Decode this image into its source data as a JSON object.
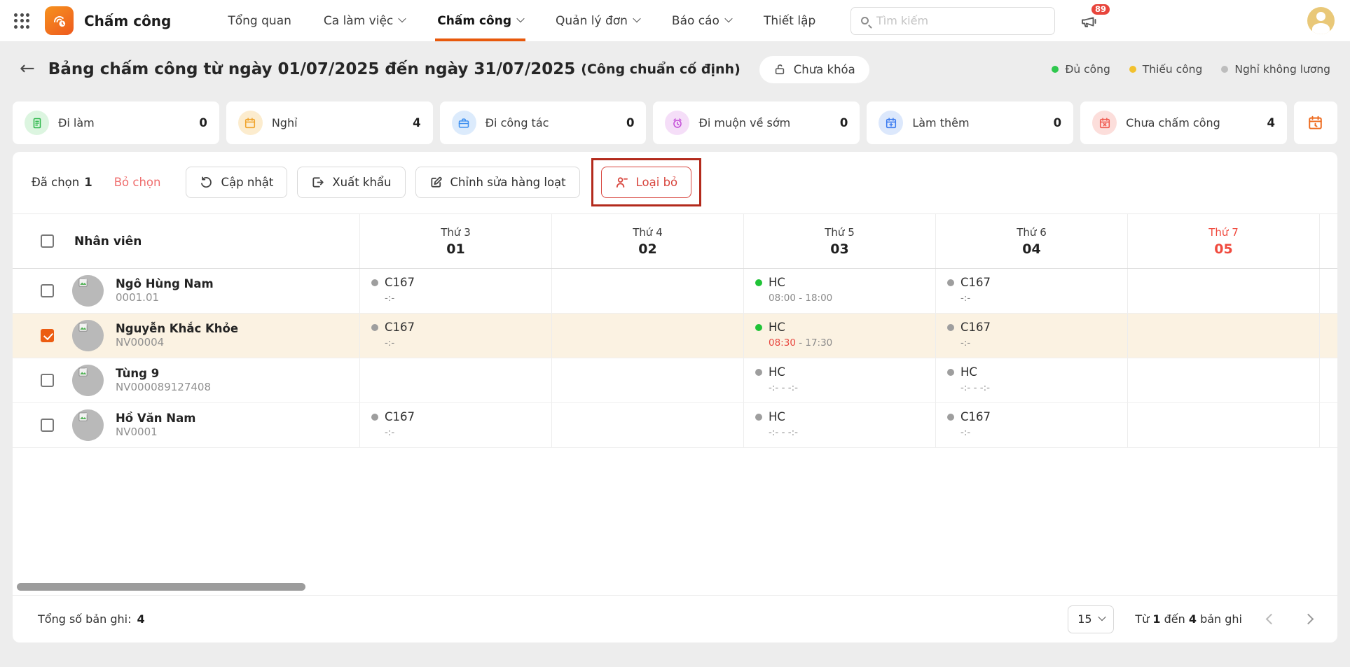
{
  "topbar": {
    "app_title": "Chấm công",
    "nav": [
      {
        "label": "Tổng quan",
        "chevron": false,
        "active": false
      },
      {
        "label": "Ca làm việc",
        "chevron": true,
        "active": false
      },
      {
        "label": "Chấm công",
        "chevron": true,
        "active": true
      },
      {
        "label": "Quản lý đơn",
        "chevron": true,
        "active": false
      },
      {
        "label": "Báo cáo",
        "chevron": true,
        "active": false
      },
      {
        "label": "Thiết lập",
        "chevron": false,
        "active": false
      }
    ],
    "search_placeholder": "Tìm kiếm",
    "notification_count": "89"
  },
  "page_header": {
    "title": "Bảng chấm công từ ngày 01/07/2025 đến ngày 31/07/2025",
    "subtitle": "(Công chuẩn cố định)",
    "lock_status": "Chưa khóa",
    "legend": [
      {
        "label": "Đủ công",
        "color": "#2fc84e"
      },
      {
        "label": "Thiếu công",
        "color": "#f2c12e"
      },
      {
        "label": "Nghỉ không lương",
        "color": "#bdbdbd"
      }
    ]
  },
  "status_cards": [
    {
      "label": "Đi làm",
      "count": "0",
      "icon": "attendance-doc-icon",
      "color": "#2eb84c",
      "bg": "#dcf5e0"
    },
    {
      "label": "Nghỉ",
      "count": "4",
      "icon": "leave-calendar-icon",
      "color": "#f0a32a",
      "bg": "#fcecce"
    },
    {
      "label": "Đi công tác",
      "count": "0",
      "icon": "business-trip-icon",
      "color": "#3b8ef0",
      "bg": "#dcebfc"
    },
    {
      "label": "Đi muộn về sớm",
      "count": "0",
      "icon": "late-early-alarm-icon",
      "color": "#c44fd8",
      "bg": "#f5def8"
    },
    {
      "label": "Làm thêm",
      "count": "0",
      "icon": "overtime-calendar-icon",
      "color": "#3b7bf0",
      "bg": "#dce8fc"
    },
    {
      "label": "Chưa chấm công",
      "count": "4",
      "icon": "missing-calendar-icon",
      "color": "#f05a50",
      "bg": "#fcdedb"
    }
  ],
  "toolbar": {
    "selected_label": "Đã chọn",
    "selected_count": "1",
    "deselect_label": "Bỏ chọn",
    "update_label": "Cập nhật",
    "export_label": "Xuất khẩu",
    "bulk_edit_label": "Chỉnh sửa hàng loạt",
    "remove_label": "Loại bỏ"
  },
  "table": {
    "employee_header": "Nhân viên",
    "columns": [
      {
        "weekday": "Thứ 3",
        "day": "01",
        "red": false
      },
      {
        "weekday": "Thứ 4",
        "day": "02",
        "red": false
      },
      {
        "weekday": "Thứ 5",
        "day": "03",
        "red": false
      },
      {
        "weekday": "Thứ 6",
        "day": "04",
        "red": false
      },
      {
        "weekday": "Thứ 7",
        "day": "05",
        "red": true
      }
    ],
    "rows": [
      {
        "name": "Ngô Hùng Nam",
        "code": "0001.01",
        "checked": false,
        "selected": false,
        "cells": [
          {
            "dot": "gray",
            "code": "C167",
            "time": [
              {
                "t": "-:-",
                "red": false
              }
            ]
          },
          null,
          {
            "dot": "green",
            "code": "HC",
            "time": [
              {
                "t": "08:00 - 18:00",
                "red": false
              }
            ]
          },
          {
            "dot": "gray",
            "code": "C167",
            "time": [
              {
                "t": "-:-",
                "red": false
              }
            ]
          },
          null
        ]
      },
      {
        "name": "Nguyễn Khắc Khỏe",
        "code": "NV00004",
        "checked": true,
        "selected": true,
        "cells": [
          {
            "dot": "gray",
            "code": "C167",
            "time": [
              {
                "t": "-:-",
                "red": false
              }
            ]
          },
          null,
          {
            "dot": "green",
            "code": "HC",
            "time": [
              {
                "t": "08:30",
                "red": true
              },
              {
                "t": " - 17:30",
                "red": false
              }
            ]
          },
          {
            "dot": "gray",
            "code": "C167",
            "time": [
              {
                "t": "-:-",
                "red": false
              }
            ]
          },
          null
        ]
      },
      {
        "name": "Tùng 9",
        "code": "NV000089127408",
        "checked": false,
        "selected": false,
        "cells": [
          null,
          null,
          {
            "dot": "gray",
            "code": "HC",
            "time": [
              {
                "t": "-:- - -:-",
                "red": false
              }
            ]
          },
          {
            "dot": "gray",
            "code": "HC",
            "time": [
              {
                "t": "-:- - -:-",
                "red": false
              }
            ]
          },
          null
        ]
      },
      {
        "name": "Hồ Văn Nam",
        "code": "NV0001",
        "checked": false,
        "selected": false,
        "cells": [
          {
            "dot": "gray",
            "code": "C167",
            "time": [
              {
                "t": "-:-",
                "red": false
              }
            ]
          },
          null,
          {
            "dot": "gray",
            "code": "HC",
            "time": [
              {
                "t": "-:- - -:-",
                "red": false
              }
            ]
          },
          {
            "dot": "gray",
            "code": "C167",
            "time": [
              {
                "t": "-:-",
                "red": false
              }
            ]
          },
          null
        ]
      }
    ]
  },
  "footer": {
    "total_label": "Tổng số bản ghi:",
    "total_value": "4",
    "page_size": "15",
    "range": {
      "prefix": "Từ ",
      "from": "1",
      "mid": " đến ",
      "to": "4",
      "suffix": " bản ghi"
    }
  },
  "colors": {
    "brand_orange": "#e8590c",
    "selected_row_bg": "#fbf2e2",
    "annotation_red": "#b32a1c",
    "remove_red": "#d8463e",
    "dot_green": "#20c337",
    "dot_gray": "#9e9e9e"
  }
}
